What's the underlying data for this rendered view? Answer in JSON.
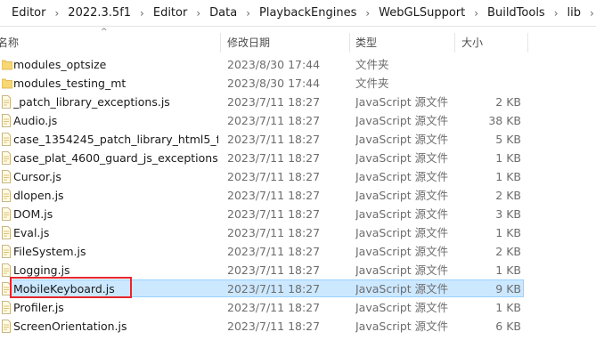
{
  "breadcrumb": [
    "Editor",
    "2022.3.5f1",
    "Editor",
    "Data",
    "PlaybackEngines",
    "WebGLSupport",
    "BuildTools",
    "lib"
  ],
  "breadcrumb_separator": "›",
  "columns": {
    "name": "名称",
    "date": "修改日期",
    "type": "类型",
    "size": "大小"
  },
  "sort_indicator": "^",
  "files": [
    {
      "icon": "folder-icon",
      "name": "modules_optsize",
      "date": "2023/8/30 17:44",
      "type": "文件夹",
      "size": ""
    },
    {
      "icon": "folder-icon",
      "name": "modules_testing_mt",
      "date": "2023/8/30 17:44",
      "type": "文件夹",
      "size": ""
    },
    {
      "icon": "js-file-icon",
      "name": "_patch_library_exceptions.js",
      "date": "2023/7/11 18:27",
      "type": "JavaScript 源文件",
      "size": "2 KB"
    },
    {
      "icon": "js-file-icon",
      "name": "Audio.js",
      "date": "2023/7/11 18:27",
      "type": "JavaScript 源文件",
      "size": "38 KB"
    },
    {
      "icon": "js-file-icon",
      "name": "case_1354245_patch_library_html5_fir...",
      "date": "2023/7/11 18:27",
      "type": "JavaScript 源文件",
      "size": "5 KB"
    },
    {
      "icon": "js-file-icon",
      "name": "case_plat_4600_guard_js_exceptions.js",
      "date": "2023/7/11 18:27",
      "type": "JavaScript 源文件",
      "size": "1 KB"
    },
    {
      "icon": "js-file-icon",
      "name": "Cursor.js",
      "date": "2023/7/11 18:27",
      "type": "JavaScript 源文件",
      "size": "1 KB"
    },
    {
      "icon": "js-file-icon",
      "name": "dlopen.js",
      "date": "2023/7/11 18:27",
      "type": "JavaScript 源文件",
      "size": "2 KB"
    },
    {
      "icon": "js-file-icon",
      "name": "DOM.js",
      "date": "2023/7/11 18:27",
      "type": "JavaScript 源文件",
      "size": "3 KB"
    },
    {
      "icon": "js-file-icon",
      "name": "Eval.js",
      "date": "2023/7/11 18:27",
      "type": "JavaScript 源文件",
      "size": "1 KB"
    },
    {
      "icon": "js-file-icon",
      "name": "FileSystem.js",
      "date": "2023/7/11 18:27",
      "type": "JavaScript 源文件",
      "size": "2 KB"
    },
    {
      "icon": "js-file-icon",
      "name": "Logging.js",
      "date": "2023/7/11 18:27",
      "type": "JavaScript 源文件",
      "size": "1 KB"
    },
    {
      "icon": "js-file-icon",
      "name": "MobileKeyboard.js",
      "date": "2023/7/11 18:27",
      "type": "JavaScript 源文件",
      "size": "9 KB",
      "selected": true
    },
    {
      "icon": "js-file-icon",
      "name": "Profiler.js",
      "date": "2023/7/11 18:27",
      "type": "JavaScript 源文件",
      "size": "1 KB"
    },
    {
      "icon": "js-file-icon",
      "name": "ScreenOrientation.js",
      "date": "2023/7/11 18:27",
      "type": "JavaScript 源文件",
      "size": "6 KB"
    }
  ],
  "colors": {
    "selection_fill": "#cce8ff",
    "selection_border": "#99d1ff",
    "annotation_box": "#e8262c",
    "folder": "#f8d775"
  }
}
